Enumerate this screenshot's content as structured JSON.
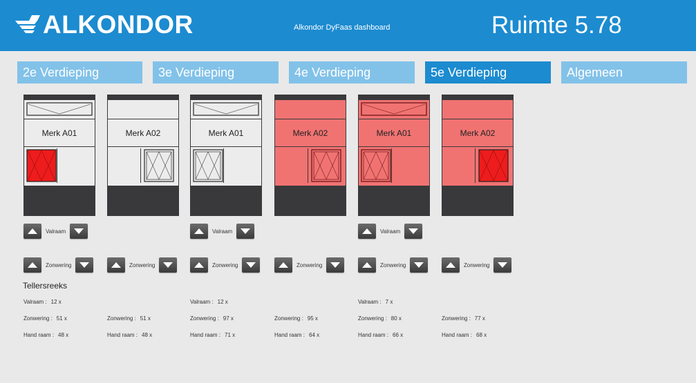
{
  "header": {
    "logo": "ALKONDOR",
    "subtitle": "Alkondor DyFaas dashboard",
    "room": "Ruimte 5.78"
  },
  "tabs": [
    {
      "label": "2e Verdieping",
      "active": false
    },
    {
      "label": "3e Verdieping",
      "active": false
    },
    {
      "label": "4e Verdieping",
      "active": false
    },
    {
      "label": "5e Verdieping",
      "active": true
    },
    {
      "label": "Algemeen",
      "active": false
    }
  ],
  "colors": {
    "brand_blue": "#1c8bd0",
    "tab_light": "#82c2e9",
    "alarm_red": "#f07372",
    "alarm_dark_red": "#ee1c1c"
  },
  "windows": [
    {
      "label": "Merk A01",
      "state": "normal",
      "left_pane": "open-red",
      "right_pane": "blank"
    },
    {
      "label": "Merk A02",
      "state": "normal",
      "left_pane": "blank",
      "right_pane": "closed"
    },
    {
      "label": "Merk A01",
      "state": "normal",
      "left_pane": "closed",
      "right_pane": "blank"
    },
    {
      "label": "Merk A02",
      "state": "alarm",
      "left_pane": "blank",
      "right_pane": "closed"
    },
    {
      "label": "Merk A01",
      "state": "alarm",
      "left_pane": "closed",
      "right_pane": "blank"
    },
    {
      "label": "Merk A02",
      "state": "alarm",
      "left_pane": "blank",
      "right_pane": "open-red"
    }
  ],
  "controls": {
    "valraam": "Valraam",
    "zonwering": "Zonwering"
  },
  "teller": {
    "title": "Tellersreeks",
    "columns": [
      {
        "valraam_label": "Valraam :",
        "valraam": "12 x",
        "zonwering_label": "Zonwering :",
        "zonwering": "51 x",
        "hand_label": "Hand raam :",
        "hand": "48 x"
      },
      {
        "zonwering_label": "Zonwering :",
        "zonwering": "51 x",
        "hand_label": "Hand raam :",
        "hand": "48 x"
      },
      {
        "valraam_label": "Valraam :",
        "valraam": "12 x",
        "zonwering_label": "Zonwering :",
        "zonwering": "97 x",
        "hand_label": "Hand raam :",
        "hand": "71 x"
      },
      {
        "zonwering_label": "Zonwering :",
        "zonwering": "95 x",
        "hand_label": "Hand raam :",
        "hand": "64 x"
      },
      {
        "valraam_label": "Valraam :",
        "valraam": "7 x",
        "zonwering_label": "Zonwering :",
        "zonwering": "80 x",
        "hand_label": "Hand raam :",
        "hand": "66 x"
      },
      {
        "zonwering_label": "Zonwering :",
        "zonwering": "77 x",
        "hand_label": "Hand raam :",
        "hand": "68 x"
      }
    ]
  }
}
